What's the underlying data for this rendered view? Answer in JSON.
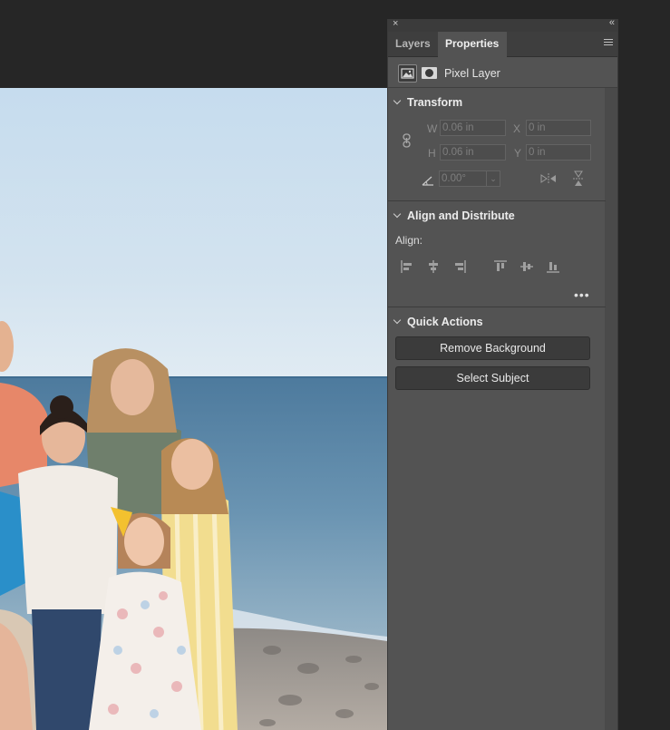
{
  "panel": {
    "close_glyph": "×",
    "collapse_glyph": "«",
    "tabs": [
      {
        "label": "Layers",
        "active": false
      },
      {
        "label": "Properties",
        "active": true
      }
    ],
    "menu_icon": "hamburger-menu-icon",
    "layer_kind_label": "Pixel Layer"
  },
  "transform": {
    "title": "Transform",
    "w_label": "W",
    "w_value": "0.06 in",
    "h_label": "H",
    "h_value": "0.06 in",
    "x_label": "X",
    "x_value": "0 in",
    "y_label": "Y",
    "y_value": "0 in",
    "angle_value": "0.00°"
  },
  "align": {
    "title": "Align and Distribute",
    "label": "Align:",
    "more": "•••"
  },
  "quick_actions": {
    "title": "Quick Actions",
    "remove_background": "Remove Background",
    "select_subject": "Select Subject"
  },
  "colors": {
    "panel_bg": "#535353",
    "app_bg": "#262626",
    "tab_bar": "#3e3e3e",
    "button_bg": "#3b3b3b"
  }
}
